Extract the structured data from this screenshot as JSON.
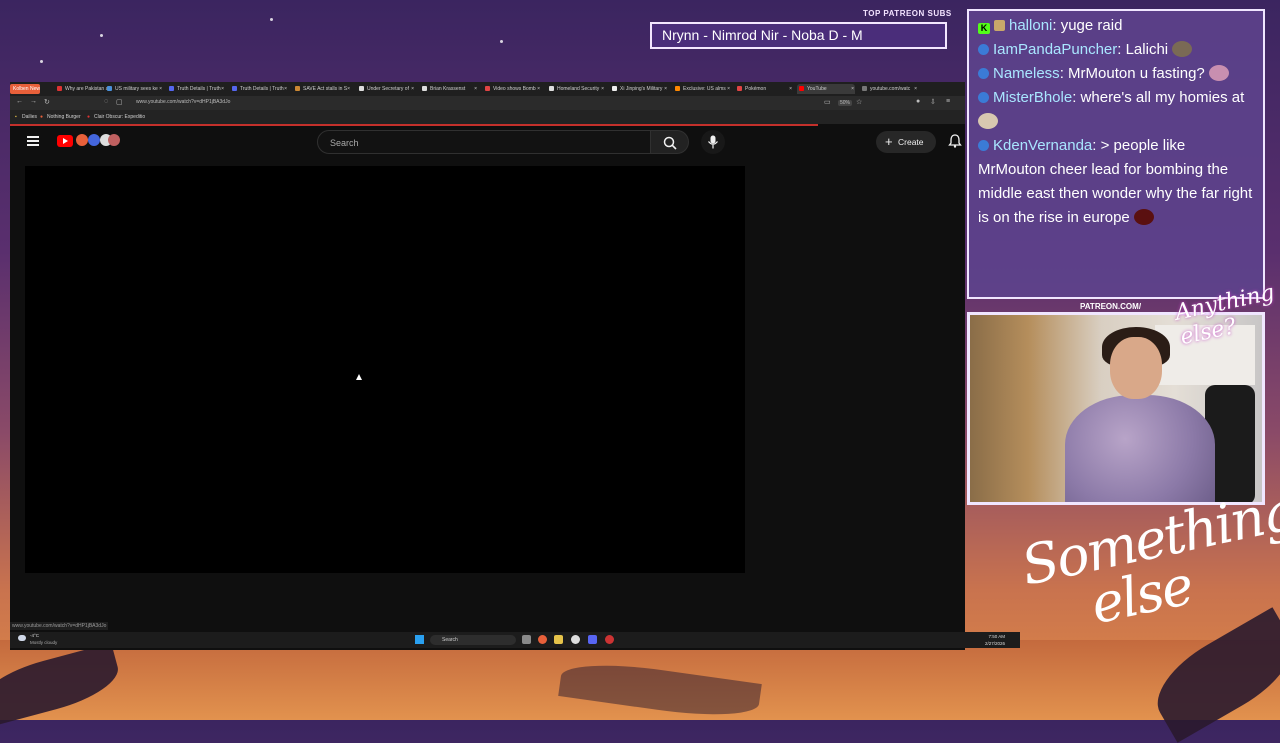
{
  "patreon": {
    "title": "TOP PATREON SUBS",
    "ticker": "Nrynn - Nimrod Nir - Noba D - M"
  },
  "browser": {
    "tabs": [
      {
        "label": "Kolben News",
        "fav": "#e8603a",
        "pinned": true
      },
      {
        "label": "Why are Pakistan a",
        "fav": "#d33"
      },
      {
        "label": "US military sees ke",
        "fav": "#4a90d9"
      },
      {
        "label": "Truth Details | Truth",
        "fav": "#5566ee"
      },
      {
        "label": "Truth Details | Truth",
        "fav": "#5566ee"
      },
      {
        "label": "SAVE Act stalls in S",
        "fav": "#cc8833"
      },
      {
        "label": "Under Secretary of",
        "fav": "#dddddd"
      },
      {
        "label": "Brian Krassenst",
        "fav": "#dddddd"
      },
      {
        "label": "Video shows Bomb",
        "fav": "#e04444"
      },
      {
        "label": "Homeland Security",
        "fav": "#dddddd"
      },
      {
        "label": "Xi Jinping's Military",
        "fav": "#eeeeee"
      },
      {
        "label": "Exclusive: US alms",
        "fav": "#ff8800"
      },
      {
        "label": "Pokémon",
        "fav": "#e04444"
      },
      {
        "label": "YouTube",
        "fav": "#ff0000",
        "active": true
      },
      {
        "label": "youtube.com/watc",
        "fav": "#777777"
      }
    ],
    "url": "www.youtube.com/watch?v=dHP1jBA3dJo",
    "zoom": "50%",
    "bookmarks": [
      "Dailies",
      "Nothing Burger",
      "Clair Obscur: Expeditio"
    ],
    "status_url": "www.youtube.com/watch?v=dHP1jBA3dJo"
  },
  "youtube": {
    "search_placeholder": "Search",
    "create_label": "Create"
  },
  "taskbar": {
    "weather_temp": "-4°C",
    "weather_cond": "Mostly cloudy",
    "search_label": "Search",
    "time": "7:50 AM",
    "date": "2/27/2026"
  },
  "chat": [
    {
      "user": "halloni",
      "text": "yuge raid",
      "badges": [
        "kick",
        "square"
      ]
    },
    {
      "user": "IamPandaPuncher",
      "text": "Lalichi",
      "badges": [
        "sub"
      ],
      "emote": "#7a6a55"
    },
    {
      "user": "Nameless",
      "text": "MrMouton u fasting?",
      "badges": [
        "sub"
      ],
      "emote": "#c88fb0"
    },
    {
      "user": "MisterBhole",
      "text": "where's all my homies at",
      "badges": [
        "sub"
      ],
      "emote": "#d8c8b0"
    },
    {
      "user": "KdenVernanda",
      "text": "> people like MrMouton cheer lead for bombing the middle east then wonder why the far right is on the rise in europe",
      "badges": [
        "sub"
      ],
      "emote": "#5a1010"
    }
  ],
  "cam": {
    "patreon_tag": "PATREON.COM/",
    "brand_small": "Anything else?"
  },
  "brand": {
    "line1": "Something",
    "line2": "else"
  }
}
